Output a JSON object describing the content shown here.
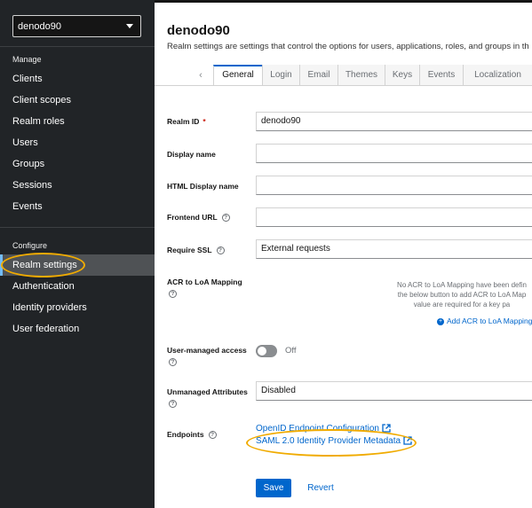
{
  "sidebar": {
    "realm_selector": "denodo90",
    "manage_heading": "Manage",
    "manage_items": [
      {
        "label": "Clients"
      },
      {
        "label": "Client scopes"
      },
      {
        "label": "Realm roles"
      },
      {
        "label": "Users"
      },
      {
        "label": "Groups"
      },
      {
        "label": "Sessions"
      },
      {
        "label": "Events"
      }
    ],
    "configure_heading": "Configure",
    "configure_items": [
      {
        "label": "Realm settings",
        "active": true
      },
      {
        "label": "Authentication"
      },
      {
        "label": "Identity providers"
      },
      {
        "label": "User federation"
      }
    ]
  },
  "header": {
    "title": "denodo90",
    "description": "Realm settings are settings that control the options for users, applications, roles, and groups in th"
  },
  "tabs": [
    {
      "label": "General",
      "active": true
    },
    {
      "label": "Login"
    },
    {
      "label": "Email"
    },
    {
      "label": "Themes"
    },
    {
      "label": "Keys"
    },
    {
      "label": "Events"
    },
    {
      "label": "Localization"
    }
  ],
  "form": {
    "realm_id": {
      "label": "Realm ID",
      "required_mark": "*",
      "value": "denodo90"
    },
    "display_name": {
      "label": "Display name",
      "value": ""
    },
    "html_display_name": {
      "label": "HTML Display name",
      "value": ""
    },
    "frontend_url": {
      "label": "Frontend URL",
      "value": ""
    },
    "require_ssl": {
      "label": "Require SSL",
      "value": "External requests"
    },
    "acr_mapping": {
      "label": "ACR to LoA Mapping",
      "empty_text_1": "No ACR to LoA Mapping have been defin",
      "empty_text_2": "the below button to add ACR to LoA Map",
      "empty_text_3": "value are required for a key pa",
      "add_label": "Add ACR to LoA Mapping"
    },
    "user_managed_access": {
      "label": "User-managed access",
      "state": "Off"
    },
    "unmanaged_attributes": {
      "label": "Unmanaged Attributes",
      "value": "Disabled"
    },
    "endpoints": {
      "label": "Endpoints",
      "links": [
        {
          "label": "OpenID Endpoint Configuration"
        },
        {
          "label": "SAML 2.0 Identity Provider Metadata"
        }
      ]
    }
  },
  "actions": {
    "save_label": "Save",
    "revert_label": "Revert"
  },
  "colors": {
    "sidebar_bg": "#212427",
    "accent": "#0066cc",
    "annotation": "#f0ab00",
    "required": "#c9190b"
  }
}
